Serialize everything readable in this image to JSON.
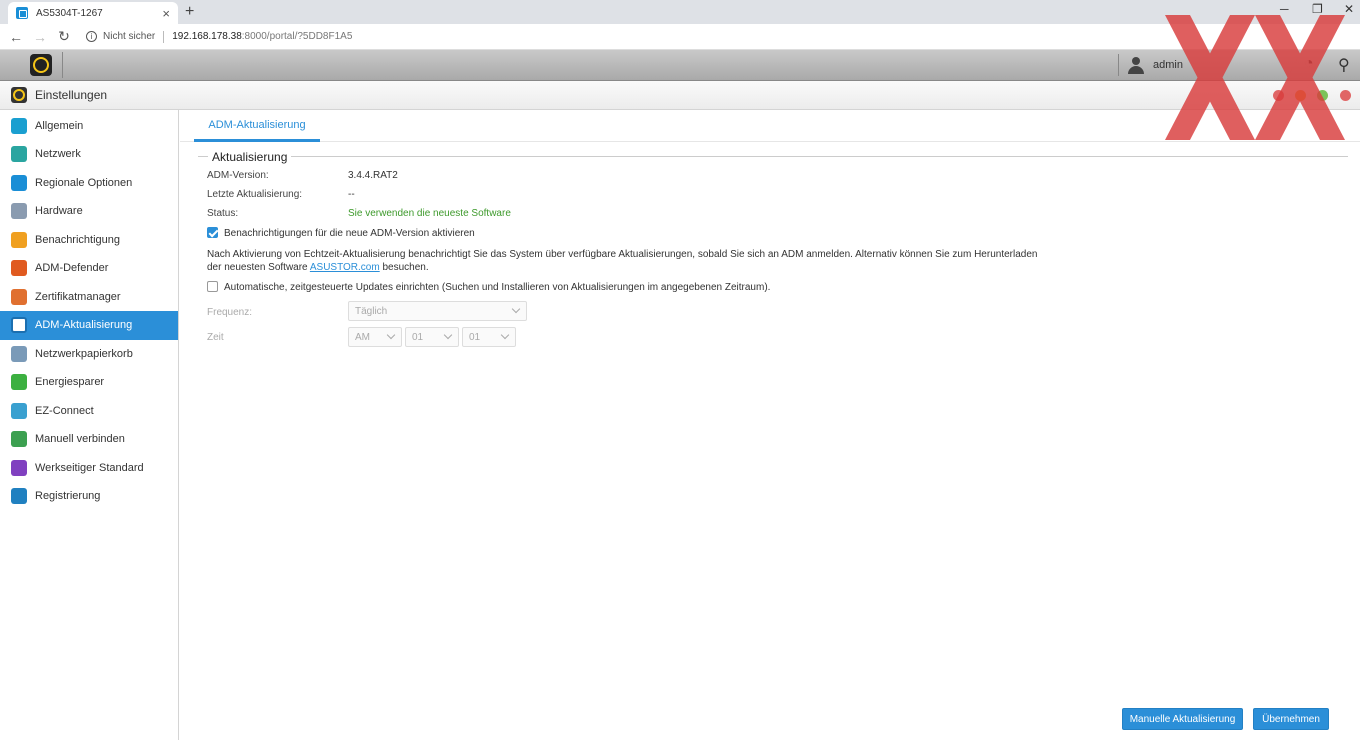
{
  "browser": {
    "tab_title": "AS5304T-1267",
    "tab_close": "×",
    "new_tab": "+",
    "not_secure": "Nicht sicher",
    "url_host": "192.168.178.38",
    "url_path": ":8000/portal/?5DD8F1A5",
    "win_min": "─",
    "win_max": "❐",
    "win_close": "✕"
  },
  "adm_bar": {
    "username": "admin"
  },
  "app": {
    "title": "Einstellungen",
    "window_dots": [
      "#e06666",
      "#f0a030",
      "#7cc35a",
      "#e06666"
    ]
  },
  "sidebar": {
    "items": [
      {
        "label": "Allgemein",
        "icon_color": "#1a9fd0",
        "icon": "general-icon"
      },
      {
        "label": "Netzwerk",
        "icon_color": "#2aa5a0",
        "icon": "globe-icon"
      },
      {
        "label": "Regionale Optionen",
        "icon_color": "#1a8ed6",
        "icon": "region-icon"
      },
      {
        "label": "Hardware",
        "icon_color": "#8a9bb0",
        "icon": "hardware-icon"
      },
      {
        "label": "Benachrichtigung",
        "icon_color": "#f0a020",
        "icon": "notification-icon"
      },
      {
        "label": "ADM-Defender",
        "icon_color": "#e05a20",
        "icon": "defender-icon"
      },
      {
        "label": "Zertifikatmanager",
        "icon_color": "#e07030",
        "icon": "certificate-icon"
      },
      {
        "label": "ADM-Aktualisierung",
        "icon_color": "#ffffff",
        "icon": "update-icon",
        "active": true
      },
      {
        "label": "Netzwerkpapierkorb",
        "icon_color": "#7a9ab8",
        "icon": "recycle-bin-icon"
      },
      {
        "label": "Energiesparer",
        "icon_color": "#3cb040",
        "icon": "energy-icon"
      },
      {
        "label": "EZ-Connect",
        "icon_color": "#3aa0d0",
        "icon": "cloud-icon"
      },
      {
        "label": "Manuell verbinden",
        "icon_color": "#3ca050",
        "icon": "connect-icon"
      },
      {
        "label": "Werkseitiger Standard",
        "icon_color": "#8040c0",
        "icon": "reset-icon"
      },
      {
        "label": "Registrierung",
        "icon_color": "#2080c0",
        "icon": "registration-icon"
      }
    ]
  },
  "main": {
    "tab": "ADM-Aktualisierung",
    "section_title": "Aktualisierung",
    "adm_version_label": "ADM-Version:",
    "adm_version_value": "3.4.4.RAT2",
    "last_update_label": "Letzte Aktualisierung:",
    "last_update_value": "--",
    "status_label": "Status:",
    "status_value": "Sie verwenden die neueste Software",
    "notify_checkbox_label": "Benachrichtigungen für die neue ADM-Version aktivieren",
    "notify_checked": true,
    "info_text_1": "Nach Aktivierung von Echtzeit-Aktualisierung benachrichtigt Sie das System über verfügbare Aktualisierungen, sobald Sie sich an ADM anmelden. Alternativ können Sie zum Herunterladen der neuesten Software ",
    "info_link": "ASUSTOR.com",
    "info_text_2": " besuchen.",
    "auto_checkbox_label": "Automatische, zeitgesteuerte Updates einrichten (Suchen und Installieren von Aktualisierungen im angegebenen Zeitraum).",
    "auto_checked": false,
    "frequency_label": "Frequenz:",
    "frequency_value": "Täglich",
    "time_label": "Zeit",
    "time_ampm": "AM",
    "time_hour": "01",
    "time_minute": "01"
  },
  "buttons": {
    "manual_update": "Manuelle Aktualisierung",
    "apply": "Übernehmen"
  },
  "colors": {
    "accent": "#2b8fd8",
    "status_ok": "#3e9a2c"
  }
}
